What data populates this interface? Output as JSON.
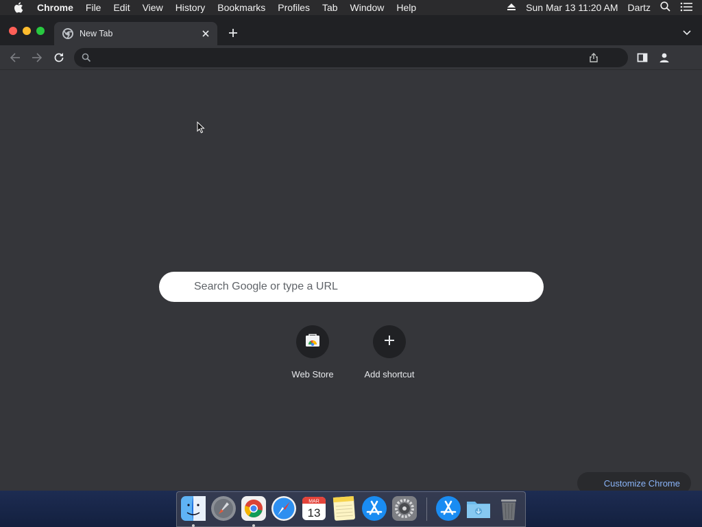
{
  "menubar": {
    "app_name": "Chrome",
    "items": [
      "File",
      "Edit",
      "View",
      "History",
      "Bookmarks",
      "Profiles",
      "Tab",
      "Window",
      "Help"
    ],
    "datetime": "Sun Mar 13  11:20 AM",
    "user": "Dartz"
  },
  "tabs": [
    {
      "title": "New Tab",
      "active": true
    }
  ],
  "toolbar": {
    "omnibox_value": ""
  },
  "ntp": {
    "search_placeholder": "Search Google or type a URL",
    "shortcuts": [
      {
        "label": "Web Store",
        "icon": "web-store-icon"
      },
      {
        "label": "Add shortcut",
        "icon": "plus-icon"
      }
    ],
    "customize_label": "Customize Chrome"
  },
  "dock": {
    "apps": [
      "finder",
      "launchpad",
      "chrome",
      "safari",
      "calendar",
      "notes",
      "app-store",
      "system-preferences",
      "app-store",
      "downloads",
      "trash"
    ],
    "calendar_month": "MAR",
    "calendar_day": "13"
  },
  "colors": {
    "window_bg": "#35363a",
    "tabstrip_bg": "#202124",
    "accent_link": "#8ab4f8"
  }
}
